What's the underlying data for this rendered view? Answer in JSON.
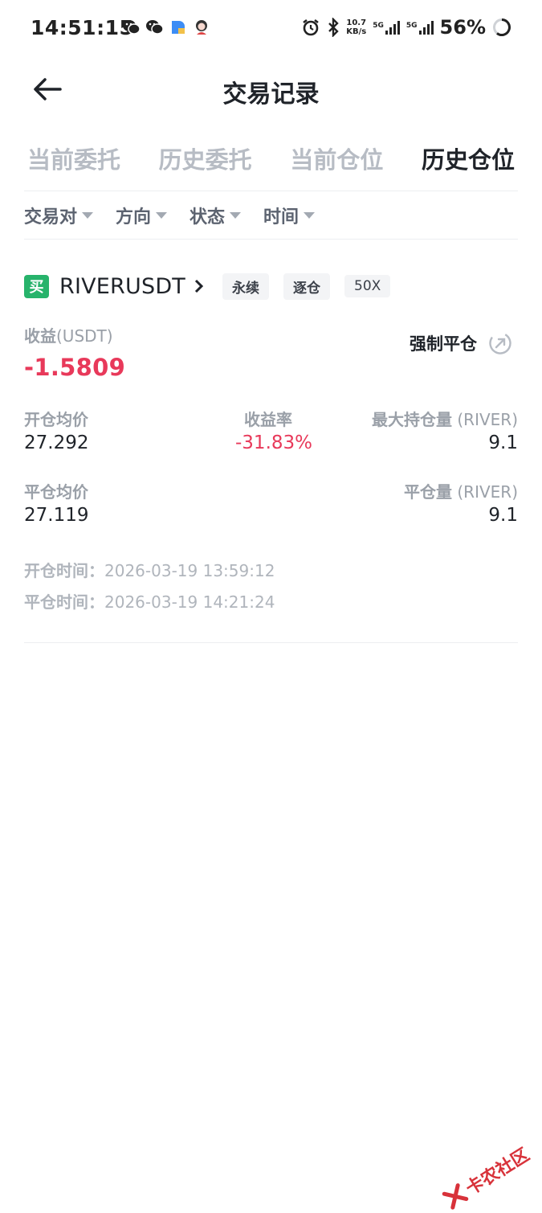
{
  "status_bar": {
    "time": "14:51:15",
    "net_speed_value": "10.7",
    "net_speed_unit": "KB/s",
    "sim1_label": "5G",
    "sim2_label": "5G",
    "battery": "56%"
  },
  "header": {
    "title": "交易记录"
  },
  "tabs": [
    {
      "label": "当前委托"
    },
    {
      "label": "历史委托"
    },
    {
      "label": "当前仓位"
    },
    {
      "label": "历史仓位"
    }
  ],
  "filters": [
    {
      "label": "交易对"
    },
    {
      "label": "方向"
    },
    {
      "label": "状态"
    },
    {
      "label": "时间"
    }
  ],
  "position": {
    "side_badge": "买",
    "symbol": "RIVERUSDT",
    "tags": [
      "永续",
      "逐仓",
      "50X"
    ],
    "pnl_label": "收益",
    "pnl_unit": "(USDT)",
    "pnl_value": "-1.5809",
    "force_close_label": "强制平仓",
    "open_price_label": "开仓均价",
    "open_price": "27.292",
    "roi_label": "收益率",
    "roi": "-31.83%",
    "max_size_label": "最大持仓量",
    "max_size_unit": "(RIVER)",
    "max_size": "9.1",
    "close_price_label": "平仓均价",
    "close_price": "27.119",
    "close_size_label": "平仓量",
    "close_size_unit": "(RIVER)",
    "close_size": "9.1",
    "open_time_label": "开仓时间：",
    "open_time": "2026-03-19 13:59:12",
    "close_time_label": "平仓时间：",
    "close_time": "2026-03-19 14:21:24"
  },
  "watermark": {
    "text": "卡农社区"
  },
  "colors": {
    "buy_green": "#27b36b",
    "loss_red": "#e8395a",
    "tab_inactive": "#b7bcc4",
    "text_primary": "#1f2329"
  }
}
